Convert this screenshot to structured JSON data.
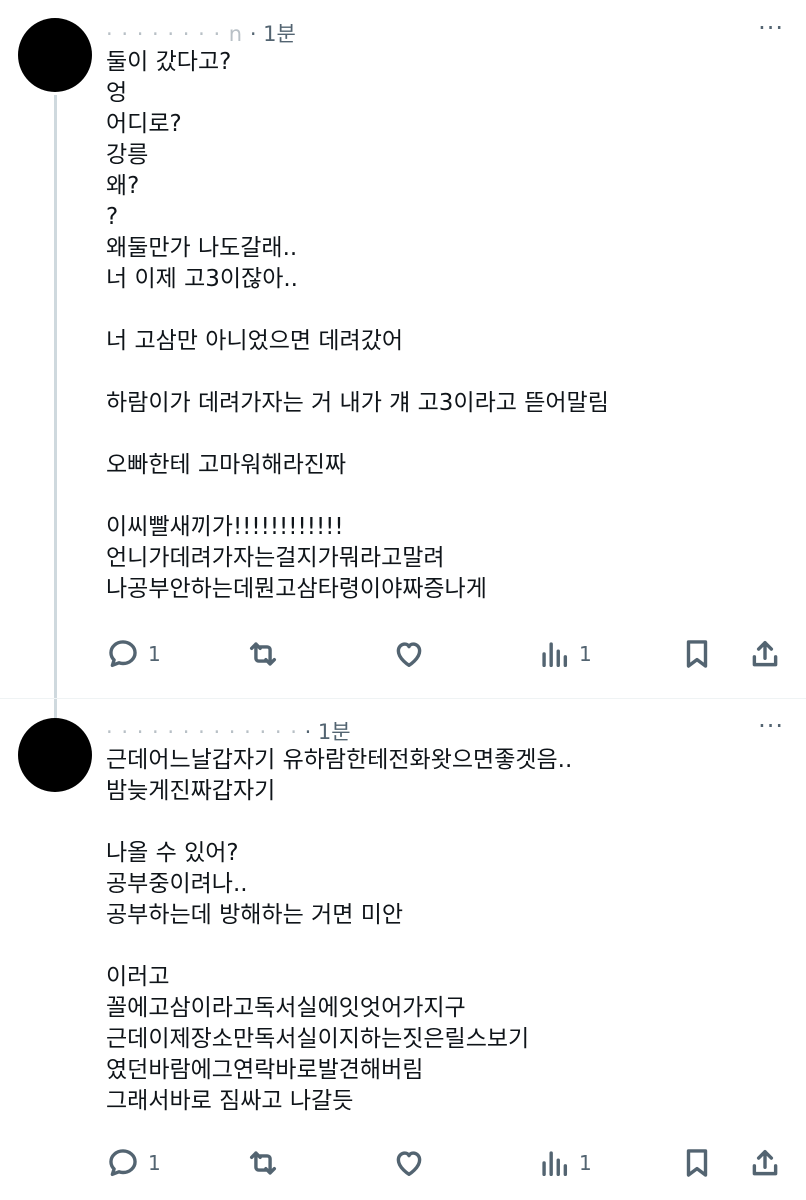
{
  "posts": [
    {
      "handle_blurred": "· · · · · · · · n",
      "time": "· 1분",
      "lines": [
        "둘이 갔다고?",
        "엉",
        "어디로?",
        "강릉",
        "왜?",
        "?",
        "왜둘만가 나도갈래..",
        "너 이제 고3이잖아..",
        "",
        "너 고삼만 아니었으면 데려갔어",
        "",
        "하람이가 데려가자는 거 내가 걔 고3이라고 뜯어말림",
        "",
        "오빠한테 고마워해라진짜",
        "",
        "이씨빨새끼가!!!!!!!!!!!!",
        "언니가데려가자는걸지가뭐라고말려",
        "나공부안하는데뭔고삼타령이야짜증나게"
      ],
      "reply_count": "1",
      "views_count": "1"
    },
    {
      "handle_blurred": "· · · · · · · · · · · · ·",
      "time": "· 1분",
      "lines": [
        "근데어느날갑자기 유하람한테전화왓으면좋겟음..",
        "밤늦게진짜갑자기",
        "",
        "나올 수 있어?",
        "공부중이려나..",
        "공부하는데 방해하는 거면 미안",
        "",
        "이러고",
        "꼴에고삼이라고독서실에잇엇어가지구",
        "근데이제장소만독서실이지하는짓은릴스보기",
        "였던바람에그연락바로발견해버림",
        "그래서바로 짐싸고 나갈듯"
      ],
      "reply_count": "1",
      "views_count": "1"
    }
  ],
  "icons": {
    "more": "more-dots-icon",
    "reply": "reply-bubble-icon",
    "repost": "repost-icon",
    "like": "heart-icon",
    "views": "views-bars-icon",
    "bookmark": "bookmark-icon",
    "share": "share-icon"
  },
  "colors": {
    "text": "#0f1419",
    "muted": "#536471",
    "thread_line": "#cfd9de"
  }
}
